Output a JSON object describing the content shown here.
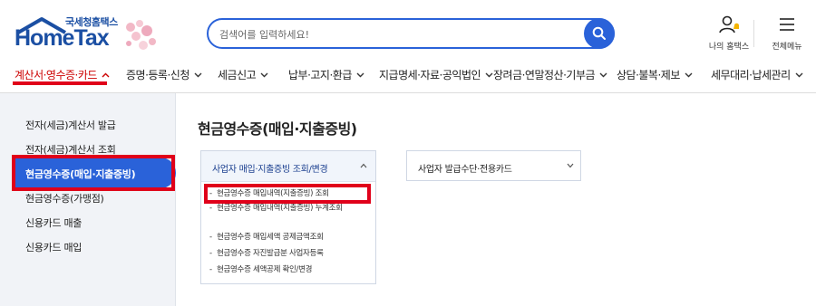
{
  "header": {
    "logo_sub": "국세청홈택스",
    "logo_main": "HomeTax",
    "search_placeholder": "검색어를 입력하세요!",
    "my_hometax_label": "나의 홈택스",
    "all_menu_label": "전체메뉴"
  },
  "nav": {
    "items": [
      {
        "label": "계산서·영수증·카드",
        "active": true
      },
      {
        "label": "증명·등록·신청"
      },
      {
        "label": "세금신고"
      },
      {
        "label": "납부·고지·환급"
      },
      {
        "label": "지급명세·자료·공익법인"
      },
      {
        "label": "장려금·연말정산·기부금"
      },
      {
        "label": "상담·불복·제보"
      },
      {
        "label": "세무대리·납세관리"
      }
    ]
  },
  "sidebar": {
    "items": [
      {
        "label": "전자(세금)계산서 발급"
      },
      {
        "label": "전자(세금)계산서 조회"
      },
      {
        "label": "현금영수증(매입·지출증빙)",
        "active": true
      },
      {
        "label": "현금영수증(가맹점)"
      },
      {
        "label": "신용카드 매출"
      },
      {
        "label": "신용카드 매입"
      }
    ]
  },
  "main": {
    "title": "현금영수증(매입·지출증빙)",
    "panel1": {
      "title": "사업자 매입·지출증빙 조회/변경",
      "items": [
        "현금영수증 매입내역(지출증빙) 조회",
        "현금영수증 매입내역(지출증빙) 누계조회",
        "현금영수증 매입세액 공제금액조회",
        "현금영수증 자진발급분 사업자등록",
        "현금영수증 세액공제 확인/변경"
      ]
    },
    "panel2": {
      "title": "사업자 발급수단·전용카드"
    }
  },
  "colors": {
    "brand_blue": "#2a62d9",
    "highlight_red": "#e0001a",
    "active_nav": "#c00000"
  }
}
